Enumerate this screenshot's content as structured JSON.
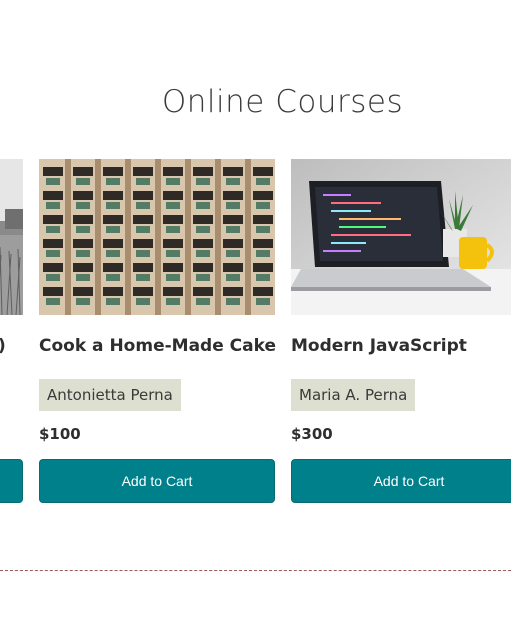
{
  "section": {
    "title": "Online Courses"
  },
  "courses": [
    {
      "title_fragment": ")",
      "image": "field-photo",
      "button_label": ""
    },
    {
      "title": "Cook a Home-Made Cake",
      "author": "Antonietta Perna",
      "price": "$100",
      "button_label": "Add to Cart",
      "image": "building-photo"
    },
    {
      "title": "Modern JavaScript",
      "author": "Maria A. Perna",
      "price": "$300",
      "button_label": "Add to Cart",
      "image": "laptop-photo"
    }
  ],
  "colors": {
    "button": "#00808b",
    "author_badge": "#dde0d0",
    "divider": "#9c5a5a"
  }
}
